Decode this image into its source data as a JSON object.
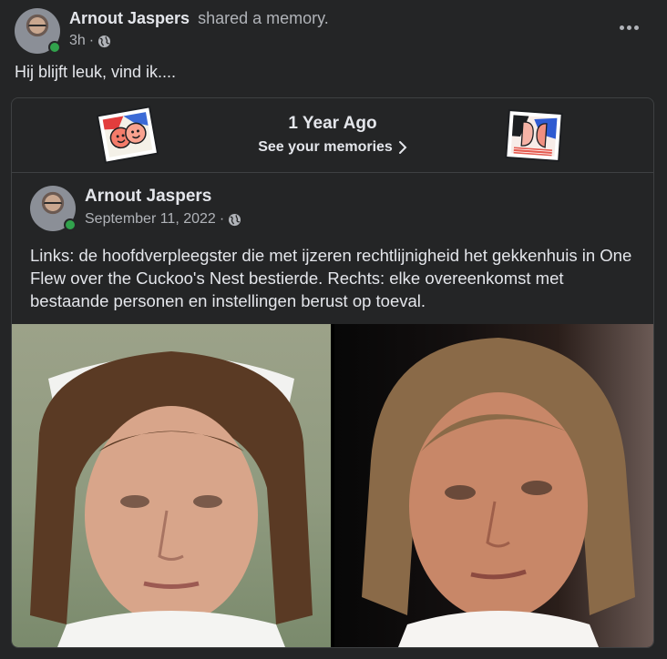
{
  "post": {
    "author": "Arnout Jaspers",
    "action": "shared a memory.",
    "time": "3h",
    "separator": "·",
    "audience_icon": "globe-icon",
    "more_icon": "more-horizontal-icon",
    "caption": "Hij blijft leuk, vind ik...."
  },
  "memory": {
    "title": "1 Year Ago",
    "link_label": "See your memories",
    "original_post": {
      "author": "Arnout Jaspers",
      "date": "September 11, 2022",
      "separator": "·",
      "text": "Links: de hoofdverpleegster die met ijzeren rechtlijnigheid het gekkenhuis in One Flew over the Cuckoo's Nest bestierde. Rechts: elke overeenkomst met bestaande personen en instellingen berust op toeval."
    },
    "photos": [
      {
        "name": "nurse-photo"
      },
      {
        "name": "woman-photo"
      }
    ]
  },
  "colors": {
    "background": "#242526",
    "text_primary": "#e4e6eb",
    "text_secondary": "#b0b3b8",
    "divider": "#3e4042",
    "online": "#31a24c"
  }
}
